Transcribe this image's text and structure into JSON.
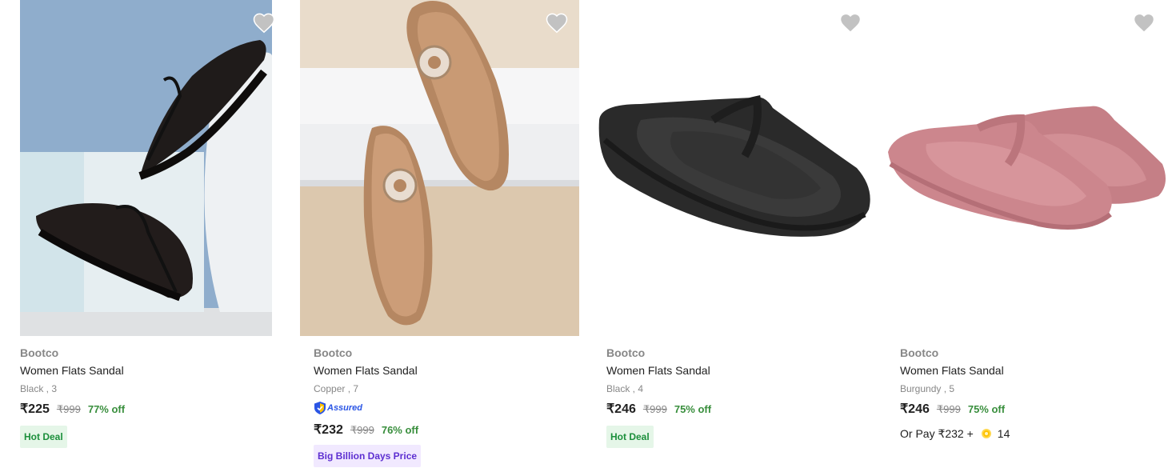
{
  "products": [
    {
      "brand": "Bootco",
      "title": "Women Flats Sandal",
      "variant": "Black , 3",
      "price": "₹225",
      "mrp": "₹999",
      "discount": "77% off",
      "badge": "Hot Deal",
      "wishlist_icon": "heart-icon",
      "image_colors": {
        "bg": "#8aaacb",
        "shoe": "#1c1716"
      }
    },
    {
      "brand": "Bootco",
      "title": "Women Flats Sandal",
      "variant": "Copper , 7",
      "assured_label": "Assured",
      "price": "₹232",
      "mrp": "₹999",
      "discount": "76% off",
      "badge": "Big Billion Days Price",
      "wishlist_icon": "heart-icon",
      "image_colors": {
        "bg": "#e7d8c6",
        "shoe": "#b8875f"
      }
    },
    {
      "brand": "Bootco",
      "title": "Women Flats Sandal",
      "variant": "Black , 4",
      "price": "₹246",
      "mrp": "₹999",
      "discount": "75% off",
      "badge": "Hot Deal",
      "wishlist_icon": "heart-icon",
      "image_colors": {
        "bg": "#ffffff",
        "shoe": "#2b2b2b"
      }
    },
    {
      "brand": "Bootco",
      "title": "Women Flats Sandal",
      "variant": "Burgundy , 5",
      "price": "₹246",
      "mrp": "₹999",
      "discount": "75% off",
      "pay_prefix": "Or Pay ₹232 +",
      "pay_coins": "14",
      "wishlist_icon": "heart-icon",
      "image_colors": {
        "bg": "#ffffff",
        "shoe": "#c98088"
      }
    }
  ],
  "colors": {
    "discount_green": "#388e3c",
    "muted_gray": "#878787",
    "heart_gray": "#c2c2c2"
  }
}
